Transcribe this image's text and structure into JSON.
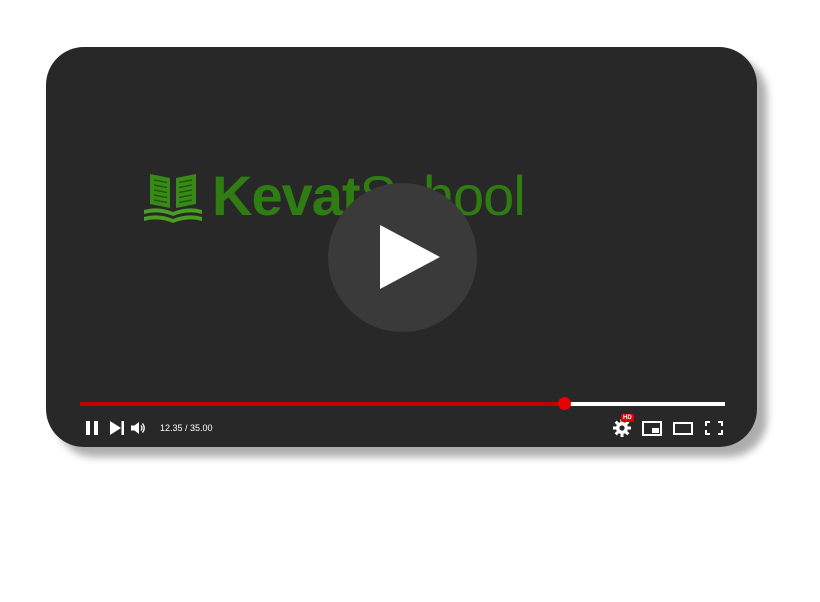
{
  "logo": {
    "word_bold": "Kevat",
    "word_light": "School",
    "brand_color": "#2f7d12"
  },
  "player": {
    "background": "#282828",
    "play_button_icon": "play-icon",
    "time_display": "12.35 / 35.00",
    "current_time": "12.35",
    "duration": "35.00",
    "progress_fraction": 0.75,
    "progress_color": "#c00000",
    "quality_badge": "HD",
    "controls": {
      "pause": "pause-icon",
      "next": "next-icon",
      "volume": "volume-icon",
      "settings": "gear-icon",
      "miniplayer": "miniplayer-icon",
      "theater": "theater-mode-icon",
      "fullscreen": "fullscreen-icon"
    }
  }
}
